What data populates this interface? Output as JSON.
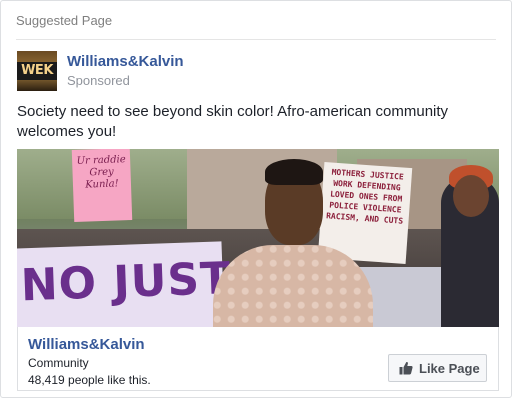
{
  "card": {
    "header_label": "Suggested Page"
  },
  "page": {
    "logo_text": "WEK",
    "name": "Williams&Kalvin",
    "sponsored_label": "Sponsored"
  },
  "post": {
    "text": "Society need to see beyond skin color! Afro-american community welcomes you!"
  },
  "photo": {
    "pink_sign_text": "Ur raddie Grey Kunla!",
    "white_sign_text": "MOTHERS JUSTICE WORK DEFENDING LOVED ONES FROM POLICE VIOLENCE RACISM, AND CUTS",
    "banner_text": "NO JUSTI"
  },
  "footer": {
    "page_name": "Williams&Kalvin",
    "category": "Community",
    "likes_text": "48,419 people like this.",
    "like_button_label": "Like Page"
  },
  "icons": {
    "like": "thumbs-up-icon"
  },
  "colors": {
    "link_blue": "#365899",
    "border": "#dddfe2",
    "muted_text": "#90949c"
  }
}
